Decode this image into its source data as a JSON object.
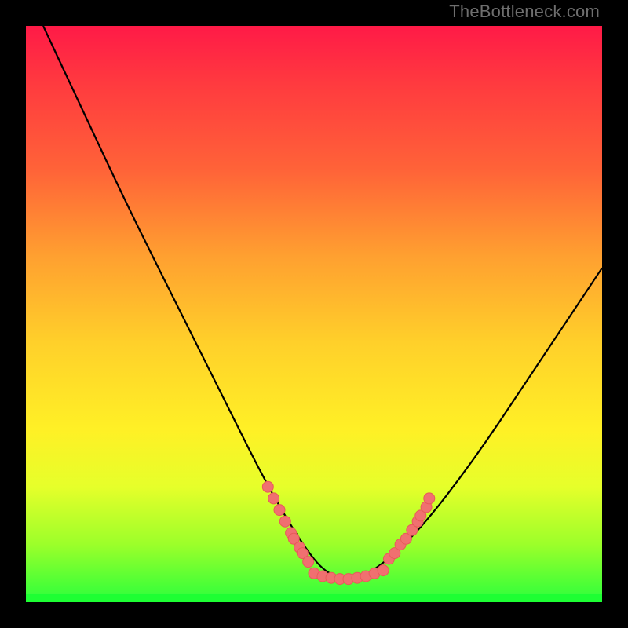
{
  "watermark": "TheBottleneck.com",
  "colors": {
    "page_bg": "#000000",
    "grad_top": "#ff1a47",
    "grad_mid": "#ffd02a",
    "grad_bottom": "#2aff3c",
    "curve_stroke": "#000000",
    "dot_fill": "#f07070",
    "dot_stroke": "#e85a5a"
  },
  "chart_data": {
    "type": "line",
    "title": "",
    "xlabel": "",
    "ylabel": "",
    "xlim": [
      0,
      100
    ],
    "ylim": [
      0,
      100
    ],
    "curve": {
      "name": "bottleneck-curve",
      "x": [
        3,
        10,
        18,
        26,
        34,
        42,
        48,
        52,
        56,
        60,
        68,
        78,
        88,
        100
      ],
      "y": [
        100,
        85,
        68,
        52,
        36,
        20,
        10,
        5,
        4,
        5,
        12,
        25,
        40,
        58
      ]
    },
    "dots_left_cluster": {
      "x": [
        42,
        43,
        44,
        45,
        46,
        46.5,
        47.5,
        48,
        49
      ],
      "y": [
        20,
        18,
        16,
        14,
        12,
        11,
        9.5,
        8.5,
        7
      ]
    },
    "dots_right_cluster": {
      "x": [
        63,
        64,
        65,
        66,
        67,
        68,
        68.5,
        69.5,
        70
      ],
      "y": [
        7.5,
        8.5,
        10,
        11,
        12.5,
        14,
        15,
        16.5,
        18
      ]
    },
    "dots_trough_cluster": {
      "x": [
        50,
        51.5,
        53,
        54.5,
        56,
        57.5,
        59,
        60.5,
        62
      ],
      "y": [
        5,
        4.5,
        4.2,
        4,
        4,
        4.2,
        4.5,
        5,
        5.5
      ]
    }
  }
}
